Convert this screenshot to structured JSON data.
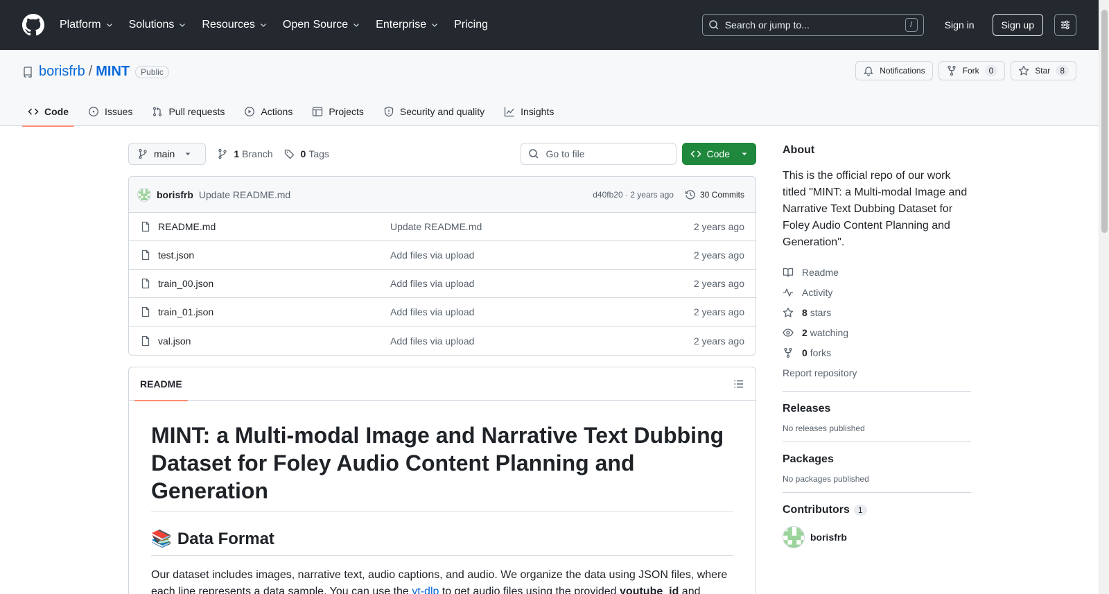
{
  "header": {
    "nav": [
      "Platform",
      "Solutions",
      "Resources",
      "Open Source",
      "Enterprise",
      "Pricing"
    ],
    "search_placeholder": "Search or jump to...",
    "search_key": "/",
    "sign_in": "Sign in",
    "sign_up": "Sign up"
  },
  "repo": {
    "owner": "borisfrb",
    "separator": "/",
    "name": "MINT",
    "visibility": "Public",
    "notifications_label": "Notifications",
    "fork_label": "Fork",
    "fork_count": "0",
    "star_label": "Star",
    "star_count": "8"
  },
  "tabs": [
    "Code",
    "Issues",
    "Pull requests",
    "Actions",
    "Projects",
    "Security and quality",
    "Insights"
  ],
  "toolbar": {
    "branch": "main",
    "branch_count": "1",
    "branch_label": "Branch",
    "tag_count": "0",
    "tag_label": "Tags",
    "goto_placeholder": "Go to file",
    "code_label": "Code"
  },
  "commit": {
    "author": "borisfrb",
    "message": "Update README.md",
    "meta": "d40fb20 · 2 years ago",
    "commits_label": "30 Commits"
  },
  "files": [
    {
      "name": "README.md",
      "message": "Update README.md",
      "date": "2 years ago"
    },
    {
      "name": "test.json",
      "message": "Add files via upload",
      "date": "2 years ago"
    },
    {
      "name": "train_00.json",
      "message": "Add files via upload",
      "date": "2 years ago"
    },
    {
      "name": "train_01.json",
      "message": "Add files via upload",
      "date": "2 years ago"
    },
    {
      "name": "val.json",
      "message": "Add files via upload",
      "date": "2 years ago"
    }
  ],
  "readme": {
    "tab": "README",
    "h1": "MINT: a Multi-modal Image and Narrative Text Dubbing Dataset for Foley Audio Content Planning and Generation",
    "h2_emoji": "📚",
    "h2": "Data Format",
    "p1": "Our dataset includes images, narrative text, audio captions, and audio. We organize the data using JSON files, where",
    "p2_start": "each line represents a data sample. You can use the ",
    "p2_link": "yt-dlp",
    "p2_mid": " to get audio files using the provided ",
    "p2_bold": "youtube_id",
    "p2_end": " and"
  },
  "about": {
    "heading": "About",
    "description": "This is the official repo of our work titled \"MINT: a Multi-modal Image and Narrative Text Dubbing Dataset for Foley Audio Content Planning and Generation\".",
    "readme": "Readme",
    "activity": "Activity",
    "stars_count": "8",
    "stars_label": "stars",
    "watching_count": "2",
    "watching_label": "watching",
    "forks_count": "0",
    "forks_label": "forks",
    "report": "Report repository"
  },
  "releases": {
    "heading": "Releases",
    "empty": "No releases published"
  },
  "packages": {
    "heading": "Packages",
    "empty": "No packages published"
  },
  "contributors": {
    "heading": "Contributors",
    "count": "1",
    "name": "borisfrb"
  }
}
